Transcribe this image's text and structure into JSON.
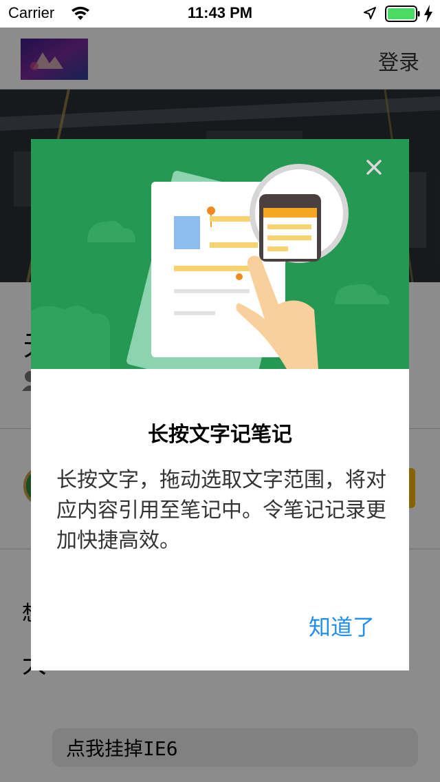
{
  "status_bar": {
    "carrier": "Carrier",
    "time": "11:43 PM"
  },
  "header": {
    "login_label": "登录"
  },
  "page": {
    "bottom_button_label_cn": "点我挂掉",
    "bottom_button_label_latin": "IE6"
  },
  "dialog": {
    "title": "长按文字记笔记",
    "description": "长按文字，拖动选取文字范围，将对应内容引用至笔记中。令笔记记录更加快捷高效。",
    "confirm_label": "知道了",
    "close_icon": "close-icon",
    "illustration": "document-magnifier-hand-illustration"
  },
  "colors": {
    "dialog_header": "#259953",
    "confirm_text": "#1f8ef1",
    "battery": "#4cd964"
  }
}
